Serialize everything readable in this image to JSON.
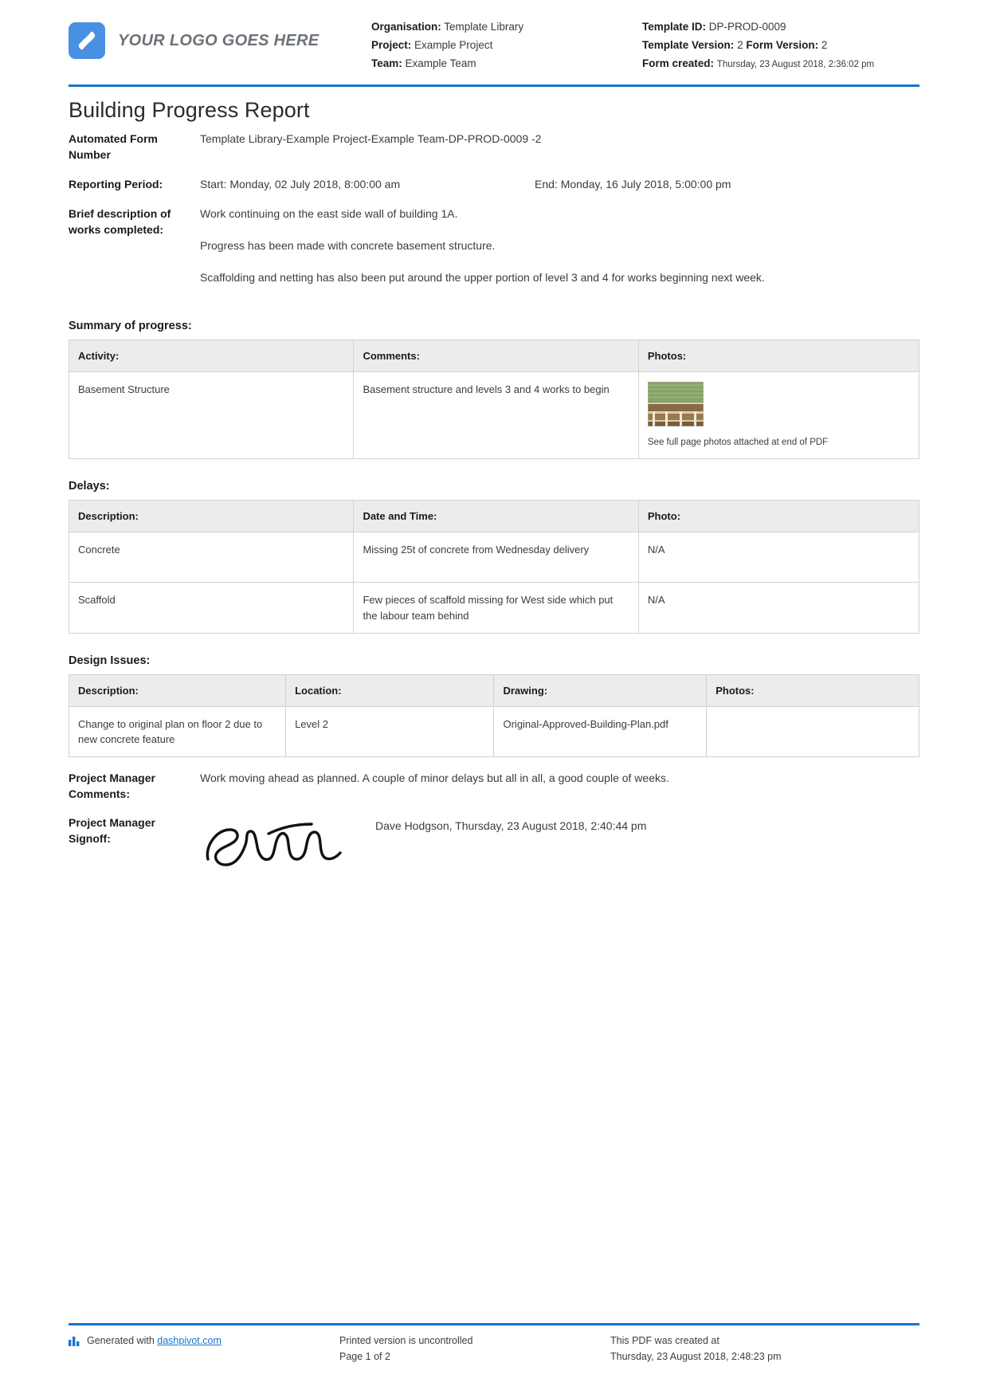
{
  "header": {
    "logo_text": "YOUR LOGO GOES HERE",
    "organisation_label": "Organisation:",
    "organisation_value": "Template Library",
    "project_label": "Project:",
    "project_value": "Example Project",
    "team_label": "Team:",
    "team_value": "Example Team",
    "template_id_label": "Template ID:",
    "template_id_value": "DP-PROD-0009",
    "template_version_label": "Template Version:",
    "template_version_value": "2",
    "form_version_label": "Form Version:",
    "form_version_value": "2",
    "form_created_label": "Form created:",
    "form_created_value": "Thursday, 23 August 2018, 2:36:02 pm"
  },
  "document": {
    "title": "Building Progress Report",
    "automated_form_number_label": "Automated Form Number",
    "automated_form_number_value": "Template Library-Example Project-Example Team-DP-PROD-0009   -2",
    "reporting_period_label": "Reporting Period:",
    "reporting_period_start": "Start: Monday, 02 July 2018, 8:00:00 am",
    "reporting_period_end": "End: Monday, 16 July 2018, 5:00:00 pm",
    "brief_description_label": "Brief description of works completed:",
    "brief_description_paragraphs": [
      "Work continuing on the east side wall of building 1A.",
      "Progress has been made with concrete basement structure.",
      "Scaffolding and netting has also been put around the upper portion of level 3 and 4 for works beginning next week."
    ]
  },
  "summary_of_progress": {
    "title": "Summary of progress:",
    "columns": [
      "Activity:",
      "Comments:",
      "Photos:"
    ],
    "rows": [
      {
        "activity": "Basement Structure",
        "comments": "Basement structure and levels 3 and 4 works to begin",
        "photo_caption": "See full page photos attached at end of PDF"
      }
    ]
  },
  "delays": {
    "title": "Delays:",
    "columns": [
      "Description:",
      "Date and Time:",
      "Photo:"
    ],
    "rows": [
      {
        "description": "Concrete",
        "date_and_time": "Missing 25t of concrete from Wednesday delivery",
        "photo": "N/A"
      },
      {
        "description": "Scaffold",
        "date_and_time": "Few pieces of scaffold missing for West side which put the labour team behind",
        "photo": "N/A"
      }
    ]
  },
  "design_issues": {
    "title": "Design Issues:",
    "columns": [
      "Description:",
      "Location:",
      "Drawing:",
      "Photos:"
    ],
    "rows": [
      {
        "description": "Change to original plan on floor 2 due to new concrete feature",
        "location": "Level 2",
        "drawing": "Original-Approved-Building-Plan.pdf",
        "photos": ""
      }
    ]
  },
  "project_manager": {
    "comments_label": "Project Manager Comments:",
    "comments_value": "Work moving ahead as planned. A couple of minor delays but all in all, a good couple of weeks.",
    "signoff_label": "Project Manager Signoff:",
    "signoff_value": "Dave Hodgson, Thursday, 23 August 2018, 2:40:44 pm"
  },
  "footer": {
    "generated_with": "Generated with",
    "generated_link": "dashpivot.com",
    "uncontrolled_notice": "Printed version is uncontrolled",
    "page_number": "Page 1 of 2",
    "created_at_label": "This PDF was created at",
    "created_at_value": "Thursday, 23 August 2018, 2:48:23 pm"
  },
  "colors": {
    "accent_blue": "#1874cd",
    "logo_blue": "#4a90e2",
    "header_grey": "#ececec"
  }
}
